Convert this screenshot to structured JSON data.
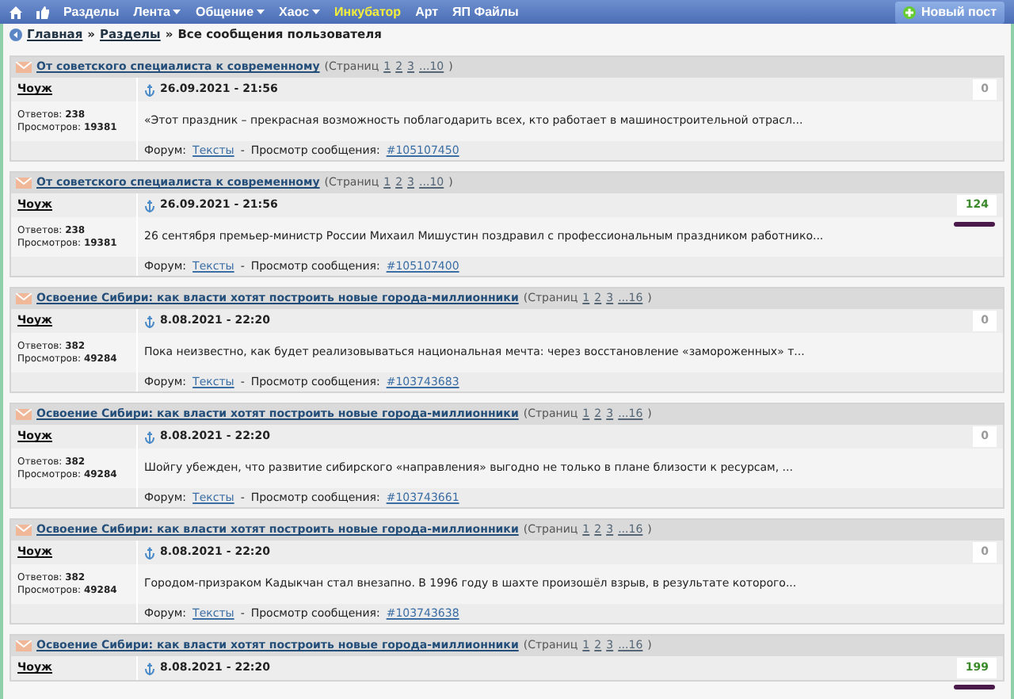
{
  "nav": {
    "items": [
      {
        "label": "Разделы",
        "dropdown": false,
        "highlight": false
      },
      {
        "label": "Лента",
        "dropdown": true,
        "highlight": false
      },
      {
        "label": "Общение",
        "dropdown": true,
        "highlight": false
      },
      {
        "label": "Хаос",
        "dropdown": true,
        "highlight": false
      },
      {
        "label": "Инкубатор",
        "dropdown": false,
        "highlight": true
      },
      {
        "label": "Арт",
        "dropdown": false,
        "highlight": false
      },
      {
        "label": "ЯП Файлы",
        "dropdown": false,
        "highlight": false
      }
    ],
    "new_post": "Новый пост"
  },
  "breadcrumb": {
    "links": [
      "Главная",
      "Разделы"
    ],
    "sep": "»",
    "current": "Все сообщения пользователя"
  },
  "posts": [
    {
      "title": "От советского специалиста к современному",
      "pages_label": "(Страниц",
      "pages": [
        "1",
        "2",
        "3",
        "...10"
      ],
      "pages_end": ")",
      "author": "Чоуж",
      "date": "26.09.2021 - 21:56",
      "score": "0",
      "score_positive": false,
      "marked": false,
      "replies_label": "Ответов:",
      "replies": "238",
      "views_label": "Просмотров:",
      "views": "19381",
      "text": "«Этот праздник – прекрасная возможность поблагодарить всех, кто работает в машиностроительной отрасл...",
      "forum_label": "Форум:",
      "forum": "Тексты",
      "view_label": "Просмотр сообщения:",
      "footer_sep": "-",
      "post_link": "#105107450"
    },
    {
      "title": "От советского специалиста к современному",
      "pages_label": "(Страниц",
      "pages": [
        "1",
        "2",
        "3",
        "...10"
      ],
      "pages_end": ")",
      "author": "Чоуж",
      "date": "26.09.2021 - 21:56",
      "score": "124",
      "score_positive": true,
      "marked": true,
      "replies_label": "Ответов:",
      "replies": "238",
      "views_label": "Просмотров:",
      "views": "19381",
      "text": "26 сентября премьер-министр России Михаил Мишустин поздравил с профессиональным праздником работнико...",
      "forum_label": "Форум:",
      "forum": "Тексты",
      "view_label": "Просмотр сообщения:",
      "footer_sep": "-",
      "post_link": "#105107400"
    },
    {
      "title": "Освоение Сибири: как власти хотят построить новые города-миллионники",
      "pages_label": "(Страниц",
      "pages": [
        "1",
        "2",
        "3",
        "...16"
      ],
      "pages_end": ")",
      "author": "Чоуж",
      "date": "8.08.2021 - 22:20",
      "score": "0",
      "score_positive": false,
      "marked": false,
      "replies_label": "Ответов:",
      "replies": "382",
      "views_label": "Просмотров:",
      "views": "49284",
      "text": "Пока неизвестно, как будет реализовываться национальная мечта: через восстановление «замороженных» т...",
      "forum_label": "Форум:",
      "forum": "Тексты",
      "view_label": "Просмотр сообщения:",
      "footer_sep": "-",
      "post_link": "#103743683"
    },
    {
      "title": "Освоение Сибири: как власти хотят построить новые города-миллионники",
      "pages_label": "(Страниц",
      "pages": [
        "1",
        "2",
        "3",
        "...16"
      ],
      "pages_end": ")",
      "author": "Чоуж",
      "date": "8.08.2021 - 22:20",
      "score": "0",
      "score_positive": false,
      "marked": false,
      "replies_label": "Ответов:",
      "replies": "382",
      "views_label": "Просмотров:",
      "views": "49284",
      "text": "Шойгу убежден, что развитие сибирского «направления» выгодно не только в плане близости к ресурсам, ...",
      "forum_label": "Форум:",
      "forum": "Тексты",
      "view_label": "Просмотр сообщения:",
      "footer_sep": "-",
      "post_link": "#103743661"
    },
    {
      "title": "Освоение Сибири: как власти хотят построить новые города-миллионники",
      "pages_label": "(Страниц",
      "pages": [
        "1",
        "2",
        "3",
        "...16"
      ],
      "pages_end": ")",
      "author": "Чоуж",
      "date": "8.08.2021 - 22:20",
      "score": "0",
      "score_positive": false,
      "marked": false,
      "replies_label": "Ответов:",
      "replies": "382",
      "views_label": "Просмотров:",
      "views": "49284",
      "text": "Городом-призраком Кадыкчан стал внезапно. В 1996 году в шахте произошёл взрыв, в результате которого...",
      "forum_label": "Форум:",
      "forum": "Тексты",
      "view_label": "Просмотр сообщения:",
      "footer_sep": "-",
      "post_link": "#103743638"
    },
    {
      "title": "Освоение Сибири: как власти хотят построить новые города-миллионники",
      "pages_label": "(Страниц",
      "pages": [
        "1",
        "2",
        "3",
        "...16"
      ],
      "pages_end": ")",
      "author": "Чоуж",
      "date": "8.08.2021 - 22:20",
      "score": "199",
      "score_positive": true,
      "marked": true
    }
  ]
}
